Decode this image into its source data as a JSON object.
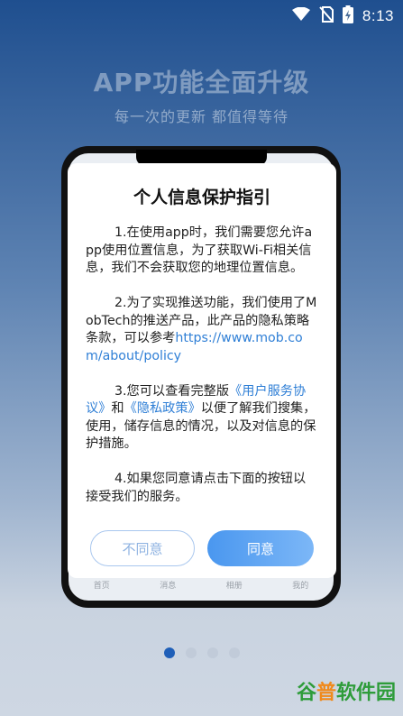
{
  "status": {
    "time": "8:13"
  },
  "headline": "APP功能全面升级",
  "subheadline": "每一次的更新 都值得等待",
  "phone_tabs": [
    "首页",
    "消息",
    "相册",
    "我的"
  ],
  "dialog": {
    "title": "个人信息保护指引",
    "para1": "1.在使用app时，我们需要您允许app使用位置信息，为了获取Wi-Fi相关信息，我们不会获取您的地理位置信息。",
    "para2": "2.为了实现推送功能，我们使用了MobTech的推送产品，此产品的隐私策略条款，可以参考",
    "para2_link": "https://www.mob.com/about/policy",
    "para3_a": "3.您可以查看完整版",
    "para3_link1": "《用户服务协议》",
    "para3_b": "和",
    "para3_link2": "《隐私政策》",
    "para3_c": "以便了解我们搜集，使用，储存信息的情况，以及对信息的保护措施。",
    "para4": "4.如果您同意请点击下面的按钮以接受我们的服务。",
    "decline_label": "不同意",
    "agree_label": "同意"
  },
  "pager": {
    "count": 4,
    "active_index": 0
  },
  "watermark": {
    "part1": "谷",
    "part2": "普",
    "part3": "软件园"
  },
  "colors": {
    "accent": "#4a97ef",
    "link": "#2f7fd6",
    "dot_active": "#1f5fb8"
  }
}
